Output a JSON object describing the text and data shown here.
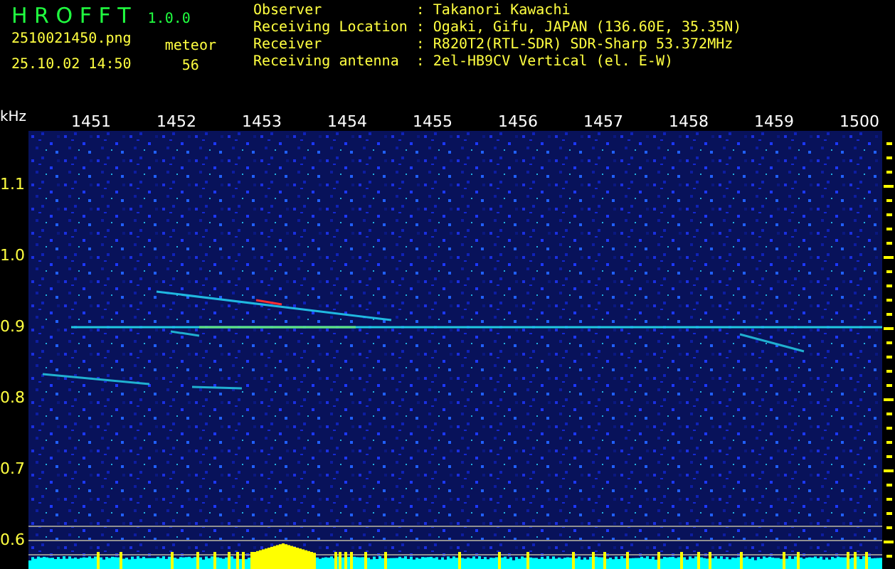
{
  "app": {
    "title": "H R O F F T",
    "version": "1.0.0"
  },
  "file": {
    "filename": "2510021450.png",
    "datetime": "25.10.02 14:50"
  },
  "meteor": {
    "label": "meteor",
    "count": "56"
  },
  "info": [
    {
      "label": "Observer",
      "separator": ":",
      "value": "Takanori Kawachi"
    },
    {
      "label": "Receiving Location",
      "separator": ":",
      "value": "Ogaki, Gifu, JAPAN (136.60E, 35.35N)"
    },
    {
      "label": "Receiver",
      "separator": ":",
      "value": "R820T2(RTL-SDR) SDR-Sharp 53.372MHz"
    },
    {
      "label": "Receiving antenna",
      "separator": ":",
      "value": "2el-HB9CV Vertical (el. E-W)"
    }
  ],
  "spectrogram": {
    "y_unit": "kHz",
    "x_labels": [
      "1451",
      "1452",
      "1453",
      "1454",
      "1455",
      "1456",
      "1457",
      "1458",
      "1459",
      "1500"
    ],
    "y_labels": [
      "1.1",
      "1.0",
      "0.9",
      "0.8",
      "0.7",
      "0.6"
    ]
  }
}
